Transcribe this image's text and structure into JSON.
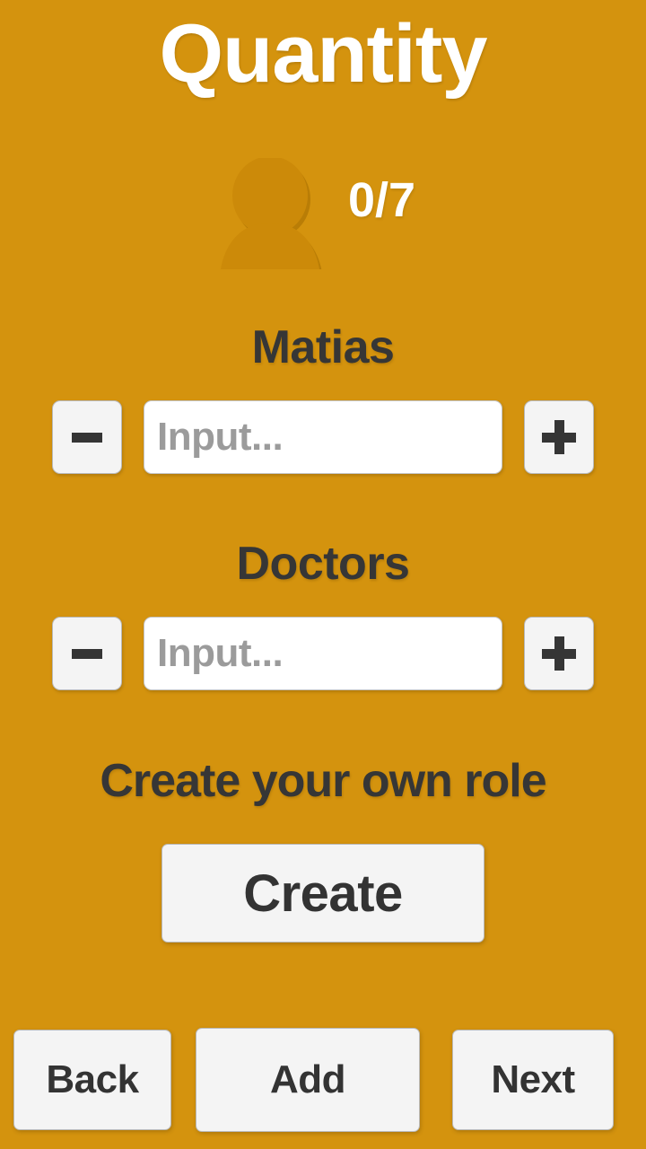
{
  "app": {
    "title": "Quantity",
    "background_color": "#d4930e",
    "title_color": "#ffffff",
    "text_color": "#363636",
    "button_color": "#f4f4f4"
  },
  "counter": {
    "icon": "person-icon",
    "value": "0/7"
  },
  "roles": [
    {
      "label": "Matias",
      "decrement_label": "-",
      "increment_label": "+",
      "input_value": "",
      "input_placeholder": "Input..."
    },
    {
      "label": "Doctors",
      "decrement_label": "-",
      "increment_label": "+",
      "input_value": "",
      "input_placeholder": "Input..."
    }
  ],
  "create_section": {
    "caption": "Create your own role",
    "button_label": "Create"
  },
  "bottom_nav": {
    "back_label": "Back",
    "add_label": "Add",
    "next_label": "Next"
  }
}
